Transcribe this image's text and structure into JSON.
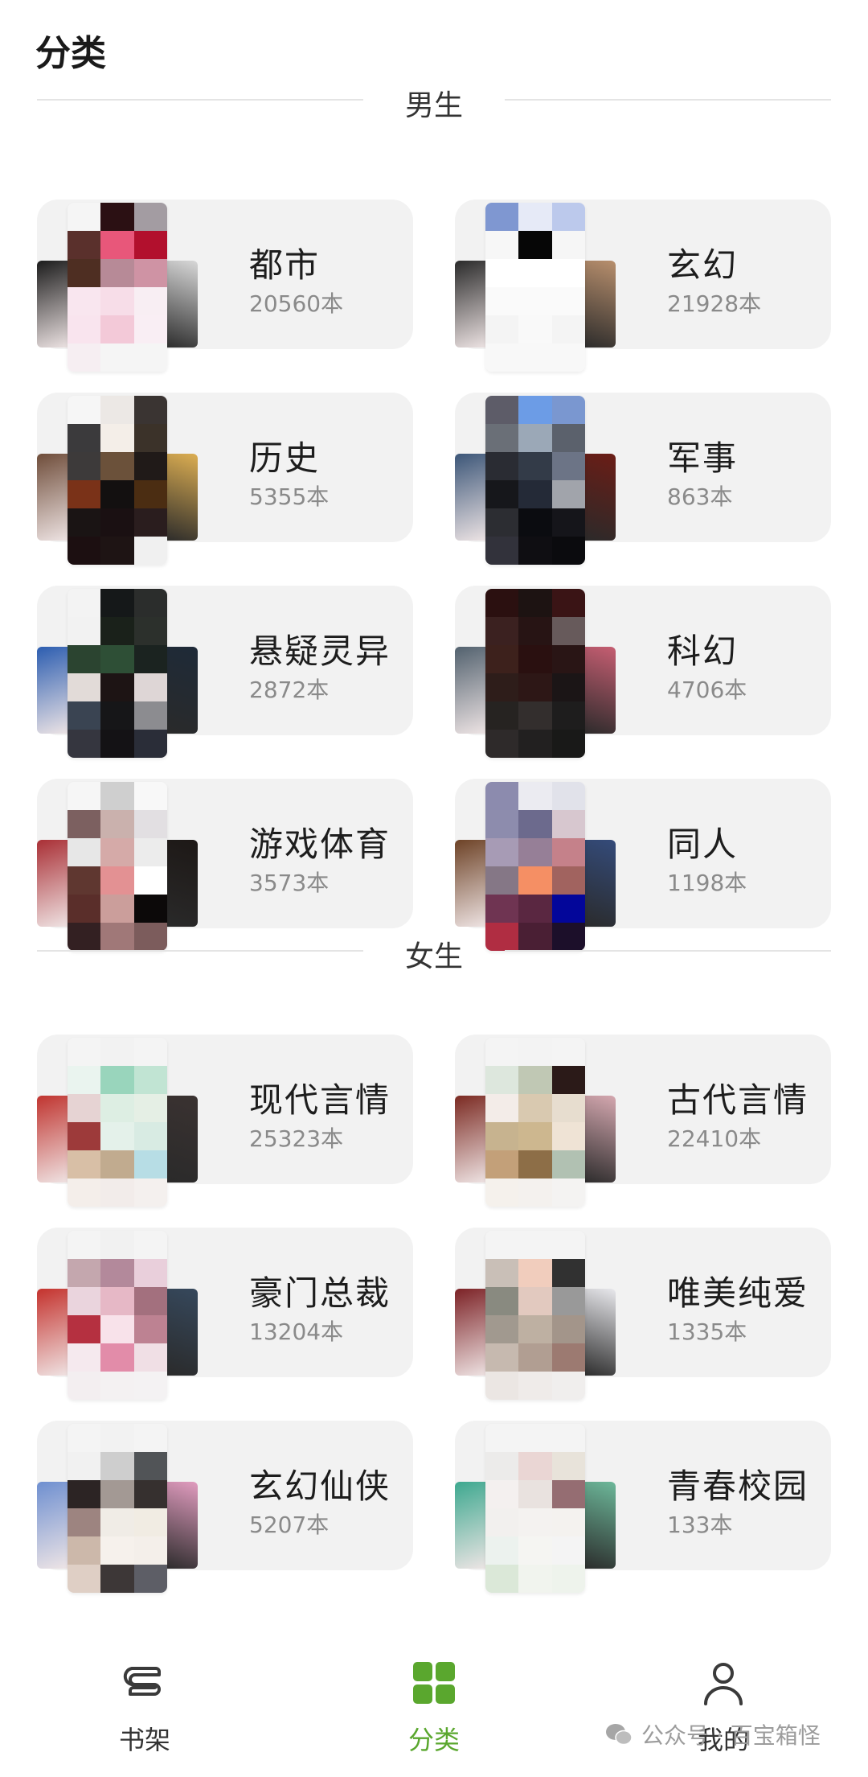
{
  "header": {
    "title": "分类"
  },
  "sections": {
    "male": {
      "label": "男生",
      "items": [
        {
          "name": "都市",
          "count": "20560本",
          "side_colors": [
            "#1b1b1b",
            "#d8d8d8"
          ],
          "palette": [
            "#f5f5f5",
            "#2b1013",
            "#a39ca2",
            "#5a302c",
            "#e8577a",
            "#b2102d",
            "#4e2e22",
            "#b78a97",
            "#cf93a4",
            "#f9e6ef",
            "#f7dde8",
            "#f8eef3",
            "#f9e4ee",
            "#f3c9d8",
            "#f9eef4",
            "#f6eef2",
            "#f5f5f5",
            "#f5f5f5"
          ]
        },
        {
          "name": "玄幻",
          "count": "21928本",
          "side_colors": [
            "#2a2a2a",
            "#b88f6d"
          ],
          "palette": [
            "#7f97d1",
            "#e6eaf7",
            "#bcc9ec",
            "#f7f7f7",
            "#060606",
            "#f6f6f6",
            "#ffffff",
            "#ffffff",
            "#ffffff",
            "#fafafa",
            "#fafafa",
            "#fafafa",
            "#f4f4f4",
            "#f9f9f9",
            "#f4f4f4",
            "#f8f8f8",
            "#f8f8f8",
            "#f8f8f8"
          ]
        },
        {
          "name": "历史",
          "count": "5355本",
          "side_colors": [
            "#6f4d3a",
            "#dcae52"
          ],
          "palette": [
            "#f6f6f6",
            "#ece8e5",
            "#3a3432",
            "#3b3a3c",
            "#f4eee8",
            "#3b3229",
            "#3d3a3a",
            "#6b513a",
            "#201a18",
            "#7a3218",
            "#131010",
            "#4b2d12",
            "#1a1414",
            "#1a1012",
            "#2a1d1e",
            "#1c0f11",
            "#1e1414",
            "#f0f0f0"
          ]
        },
        {
          "name": "军事",
          "count": "863本",
          "side_colors": [
            "#3c5678",
            "#6b1d16"
          ],
          "palette": [
            "#5d5c68",
            "#6c9ce6",
            "#7a97d0",
            "#6a6f77",
            "#9ba8b7",
            "#5b616c",
            "#2a2c33",
            "#333b48",
            "#6c7486",
            "#16171b",
            "#242a37",
            "#a1a4ab",
            "#2c2d32",
            "#0b0c10",
            "#15151a",
            "#32323b",
            "#0f0e12",
            "#0b0b0e"
          ]
        },
        {
          "name": "悬疑灵异",
          "count": "2872本",
          "side_colors": [
            "#2c5db0",
            "#1e2a38"
          ],
          "palette": [
            "#f3f3f3",
            "#151819",
            "#2b2d2c",
            "#f2f2f2",
            "#1a211a",
            "#2c302c",
            "#2b4430",
            "#2e4f36",
            "#1b2320",
            "#e2dbd8",
            "#1d1414",
            "#ded6d6",
            "#3a4452",
            "#161618",
            "#8c8c90",
            "#35363f",
            "#141215",
            "#2a2d38"
          ]
        },
        {
          "name": "科幻",
          "count": "4706本",
          "side_colors": [
            "#52616e",
            "#c65e72"
          ],
          "palette": [
            "#2b1010",
            "#1d1312",
            "#3a1415",
            "#3b2120",
            "#271414",
            "#675a5b",
            "#3d211c",
            "#2a1010",
            "#291515",
            "#2e1d1a",
            "#2d1716",
            "#1b1516",
            "#262321",
            "#332e2d",
            "#1e1d1d",
            "#2e2a2a",
            "#222020",
            "#191918"
          ]
        },
        {
          "name": "游戏体育",
          "count": "3573本",
          "side_colors": [
            "#a92f35",
            "#1d1816"
          ],
          "palette": [
            "#f6f6f6",
            "#cfcfcf",
            "#f8f8f8",
            "#7c6060",
            "#cab1ad",
            "#e2dfe2",
            "#e7e7e7",
            "#d5aaa8",
            "#ececec",
            "#5f3730",
            "#e39193",
            "#ffffff",
            "#5a2e2a",
            "#cb9e9b",
            "#0c0909",
            "#332022",
            "#a07878",
            "#7c5c5c"
          ]
        },
        {
          "name": "同人",
          "count": "1198本",
          "side_colors": [
            "#6d4226",
            "#344b7a"
          ],
          "palette": [
            "#8c8bae",
            "#ebebf1",
            "#e1e2ea",
            "#8d8cad",
            "#6c6a8d",
            "#d7c7cf",
            "#a79bb5",
            "#967f97",
            "#c5818a",
            "#857786",
            "#f58f64",
            "#a1635f",
            "#6f3452",
            "#5a2741",
            "#03069a",
            "#b02d42",
            "#4a1f34",
            "#1c0f2a"
          ]
        }
      ]
    },
    "female": {
      "label": "女生",
      "items": [
        {
          "name": "现代言情",
          "count": "25323本",
          "side_colors": [
            "#c0342f",
            "#3a3231"
          ],
          "palette": [
            "#f4f4f4",
            "#f2f2f2",
            "#f4f4f4",
            "#eaf4ef",
            "#99d5bc",
            "#c1e4d3",
            "#e6d3d3",
            "#ddeee3",
            "#e5efe5",
            "#9d3a3a",
            "#e4f1ea",
            "#d8ebe3",
            "#d8bfa6",
            "#c1ab8f",
            "#b7dde5",
            "#f4eeea",
            "#f2ecea",
            "#f4f0ee"
          ]
        },
        {
          "name": "古代言情",
          "count": "22410本",
          "side_colors": [
            "#7b2a22",
            "#d5a8b0"
          ],
          "palette": [
            "#f4f4f4",
            "#f3f3f3",
            "#f4f4f4",
            "#dde7dd",
            "#c0c8b4",
            "#2b1a18",
            "#f3ece8",
            "#d9c9b0",
            "#e7ddcf",
            "#c7b38f",
            "#cdb78f",
            "#efe3d5",
            "#c3a079",
            "#8d6e47",
            "#b1c1b2",
            "#f5f1ec",
            "#f4f1ee",
            "#f4f3f2"
          ]
        },
        {
          "name": "豪门总裁",
          "count": "13204本",
          "side_colors": [
            "#c4322d",
            "#36485c"
          ],
          "palette": [
            "#f4f4f4",
            "#f1f1f1",
            "#f4f4f4",
            "#c4a7ae",
            "#b3899b",
            "#e9cfdb",
            "#ead4dd",
            "#e6b8c6",
            "#a3707e",
            "#b53040",
            "#f8e2ea",
            "#bd8292",
            "#f5e9ee",
            "#e28ca9",
            "#f0dfe5",
            "#f3eef0",
            "#f4f1f2",
            "#f4f2f3"
          ]
        },
        {
          "name": "唯美纯爱",
          "count": "1335本",
          "side_colors": [
            "#7c2226",
            "#e8e8ec"
          ],
          "palette": [
            "#f4f4f4",
            "#f4f4f4",
            "#f4f4f4",
            "#c9bfb7",
            "#f1cdbd",
            "#313131",
            "#898a80",
            "#e2c9bf",
            "#999999",
            "#a1998f",
            "#beb0a2",
            "#a3958a",
            "#c6b9af",
            "#b19e92",
            "#9c7a71",
            "#ebe6e3",
            "#efebe9",
            "#f0eeed"
          ]
        },
        {
          "name": "玄幻仙侠",
          "count": "5207本",
          "side_colors": [
            "#6e8fd0",
            "#e19cbf"
          ],
          "palette": [
            "#f4f4f4",
            "#f2f2f2",
            "#f4f4f4",
            "#f1f1f1",
            "#cecece",
            "#515457",
            "#2c2424",
            "#a39994",
            "#36302f",
            "#9d8480",
            "#f0ece6",
            "#f1ece3",
            "#ccb8aa",
            "#f6f1ec",
            "#f4efea",
            "#dfcfc5",
            "#3d3737",
            "#5d5e66"
          ]
        },
        {
          "name": "青春校园",
          "count": "133本",
          "side_colors": [
            "#3da88f",
            "#6db89a"
          ],
          "palette": [
            "#f4f4f4",
            "#f4f4f4",
            "#f4f4f4",
            "#ecebea",
            "#ead6d4",
            "#e8e3da",
            "#f4f0ef",
            "#e9e2df",
            "#956d72",
            "#f2f0ee",
            "#f4f2f0",
            "#f4f2ef",
            "#ecf2ee",
            "#f5f5f2",
            "#f4f4f4",
            "#dbe8d8",
            "#f1f4ee",
            "#eef3ec"
          ]
        }
      ]
    }
  },
  "nav": {
    "items": [
      {
        "label": "书架",
        "icon": "bookshelf-icon",
        "active": false
      },
      {
        "label": "分类",
        "icon": "category-grid-icon",
        "active": true
      },
      {
        "label": "我的",
        "icon": "profile-icon",
        "active": false
      }
    ],
    "accent_color": "#5aa72e"
  },
  "watermark": {
    "text": "公众号 · 百宝箱怪"
  }
}
